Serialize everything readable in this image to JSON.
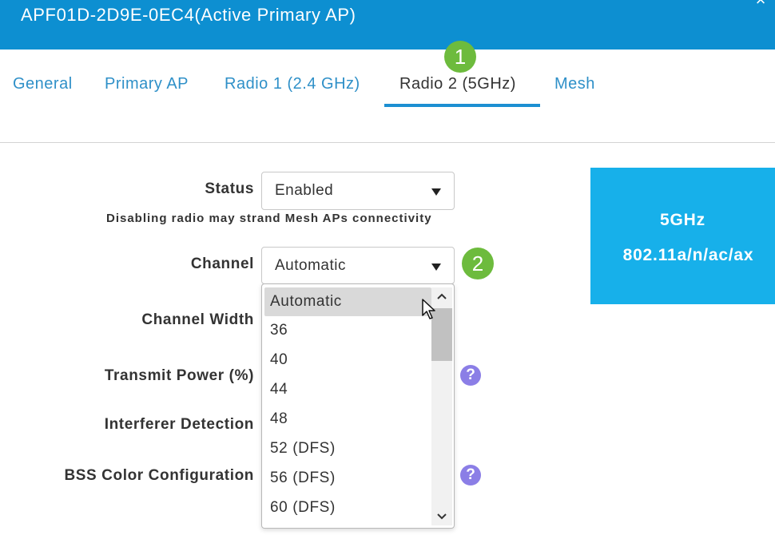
{
  "header": {
    "title": "APF01D-2D9E-0EC4(Active Primary AP)",
    "close_icon": "close-icon"
  },
  "tabs": [
    {
      "label": "General",
      "active": false
    },
    {
      "label": "Primary AP",
      "active": false
    },
    {
      "label": "Radio 1 (2.4 GHz)",
      "active": false
    },
    {
      "label": "Radio 2 (5GHz)",
      "active": true
    },
    {
      "label": "Mesh",
      "active": false
    }
  ],
  "badges": {
    "step1": "1",
    "step2": "2"
  },
  "form": {
    "status": {
      "label": "Status",
      "value": "Enabled"
    },
    "warning": "Disabling radio may strand Mesh APs connectivity",
    "channel": {
      "label": "Channel",
      "value": "Automatic"
    },
    "channel_width": {
      "label": "Channel Width"
    },
    "transmit_power": {
      "label": "Transmit Power (%)"
    },
    "interferer_detection": {
      "label": "Interferer Detection"
    },
    "bss_color": {
      "label": "BSS Color Configuration"
    },
    "help_icon_glyph": "?"
  },
  "channel_dropdown": {
    "options": [
      "Automatic",
      "36",
      "40",
      "44",
      "48",
      "52 (DFS)",
      "56 (DFS)",
      "60 (DFS)"
    ],
    "selected": "Automatic"
  },
  "band_info": {
    "frequency": "5GHz",
    "standard": "802.11a/n/ac/ax"
  },
  "colors": {
    "header_bg": "#0d8fd1",
    "tab_link": "#2f90c8",
    "tab_underline": "#1c8fd2",
    "badge_green": "#6dbb3d",
    "help_purple": "#8b7ee6",
    "band_box": "#17b0ea"
  }
}
